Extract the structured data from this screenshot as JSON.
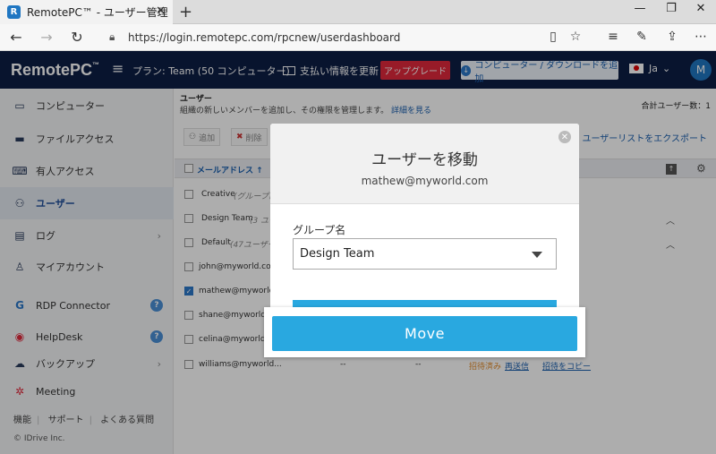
{
  "browser": {
    "tab_title": "RemotePC™ - ユーザー管理",
    "favicon_letter": "R",
    "new_tab": "+",
    "url": "https://login.remotepc.com/rpcnew/userdashboard"
  },
  "header": {
    "logo": "RemotePC",
    "logo_tm": "™",
    "plan": "プラン: Team (50 コンピューター)",
    "billing": "支払い情報を更新",
    "upgrade": "アップグレード",
    "add_download": "コンピューター / ダウンロードを追加",
    "lang": "Ja",
    "avatar": "M"
  },
  "sidebar": {
    "items": [
      {
        "label": "コンピューター",
        "icon": "monitor-icon"
      },
      {
        "label": "ファイルアクセス",
        "icon": "folder-icon"
      },
      {
        "label": "有人アクセス",
        "icon": "keyboard-icon"
      },
      {
        "label": "ユーザー",
        "icon": "users-icon"
      },
      {
        "label": "ログ",
        "icon": "log-icon"
      },
      {
        "label": "マイアカウント",
        "icon": "person-icon"
      },
      {
        "label": "RDP Connector",
        "icon": "rdp-icon"
      },
      {
        "label": "HelpDesk",
        "icon": "lifebuoy-icon"
      },
      {
        "label": "バックアップ",
        "icon": "cloud-icon"
      },
      {
        "label": "Meeting",
        "icon": "meeting-icon"
      }
    ],
    "footer": [
      "機能",
      "サポート",
      "よくある質問"
    ],
    "copyright": "© IDrive Inc."
  },
  "main": {
    "breadcrumb": "ユーザー",
    "description": "組織の新しいメンバーを追加し、その権限を管理します。",
    "details_link": "詳細を見る",
    "total": "合計ユーザー数：1",
    "toolbar": {
      "add": "追加",
      "delete": "削除"
    },
    "export": "ユーザーリストをエクスポート",
    "col_email": "メールアドレス ↑",
    "groups": [
      {
        "name": "Creative",
        "sub": "(グループに"
      },
      {
        "name": "Design Team",
        "sub": "(3 ユー"
      },
      {
        "name": "Default",
        "sub": "(47ユーザー"
      }
    ],
    "users": [
      {
        "email": "john@myworld.com"
      },
      {
        "email": "mathew@myworld...."
      },
      {
        "email": "shane@myworld.com"
      },
      {
        "email": "celina@myworld.com"
      },
      {
        "email": "williams@myworld...",
        "c1": "--",
        "c2": "--",
        "status": "招待済み",
        "resend": "再送信",
        "copy": "招待をコピー"
      }
    ]
  },
  "modal": {
    "title": "ユーザーを移動",
    "email": "mathew@myworld.com",
    "group_label": "グループ名",
    "selected_group": "Design Team",
    "move_button": "Move"
  }
}
